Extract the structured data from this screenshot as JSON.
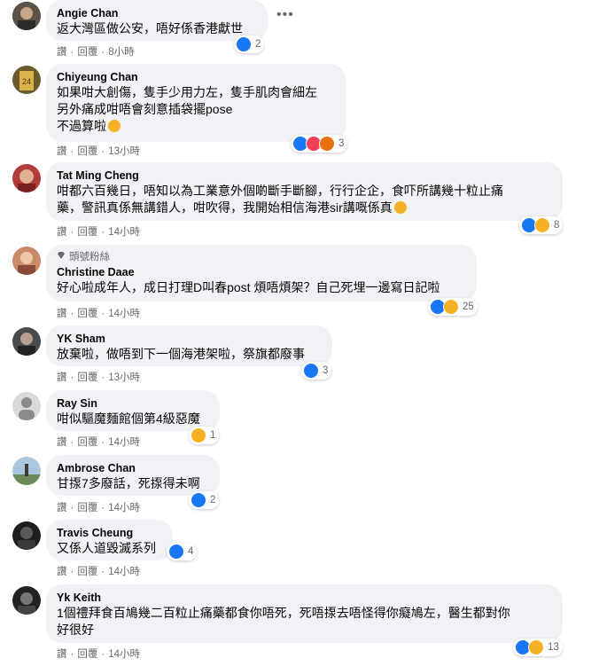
{
  "actions": {
    "like": "讚",
    "reply": "回覆"
  },
  "colors": {
    "bubble": "#f0f2f5",
    "like": "#1877f2",
    "love": "#f33e58",
    "haha": "#f7b125",
    "angry": "#e9710f",
    "meta": "#65676b"
  },
  "comments": [
    {
      "author": "Angie Chan",
      "lines": [
        "返大灣區做公安，唔好係香港獻世"
      ],
      "time": "8小時",
      "reactions": [
        "like"
      ],
      "count": "2"
    },
    {
      "author": "Chiyeung Chan",
      "lines": [
        "如果咁大創傷，隻手少用力左，隻手肌肉會細左",
        "另外痛成咁唔會刻意插袋擺pose",
        "不過算啦"
      ],
      "emoji": "slightly-smiling-face",
      "time": "13小時",
      "reactions": [
        "like",
        "love",
        "angry"
      ],
      "count": "3"
    },
    {
      "author": "Tat Ming Cheng",
      "lines": [
        "咁都六百幾日，唔知以為工業意外個啲斷手斷腳，行行企企，食吓所講幾十粒止痛",
        "藥，警訊真係無講錯人，咁吹得，我開始相信海港sir講嘅係真"
      ],
      "emoji": "rolling-laughing-face",
      "time": "14小時",
      "reactions": [
        "like",
        "haha"
      ],
      "count": "8"
    },
    {
      "author": "Christine Daae",
      "badge": "頭號粉絲",
      "badge_icon": "diamond-icon",
      "lines": [
        "好心啦成年人，成日打理D叫春post 煩唔煩架？自己死埋一邊寫日記啦"
      ],
      "time": "14小時",
      "reactions": [
        "like",
        "haha"
      ],
      "count": "25"
    },
    {
      "author": "YK Sham",
      "lines": [
        "放棄啦，做唔到下一個海港架啦，祭旗都廢事"
      ],
      "time": "13小時",
      "reactions": [
        "like"
      ],
      "count": "3"
    },
    {
      "author": "Ray Sin",
      "lines": [
        "咁似驅魔麵館個第4級惡魔"
      ],
      "time": "14小時",
      "reactions": [
        "haha"
      ],
      "count": "1"
    },
    {
      "author": "Ambrose Chan",
      "lines": [
        "甘揼7多廢話，死揼得未啊"
      ],
      "time": "14小時",
      "reactions": [
        "like"
      ],
      "count": "2"
    },
    {
      "author": "Travis Cheung",
      "lines": [
        "又係人道毀滅系列"
      ],
      "time": "14小時",
      "reactions": [
        "like"
      ],
      "count": "4"
    },
    {
      "author": "Yk Keith",
      "lines": [
        "1個禮拜食百鳩幾二百粒止痛藥都食你唔死，死唔揼去唔怪得你癡鳩左，醫生都對你",
        "好很好"
      ],
      "time": "14小時",
      "reactions": [
        "like",
        "haha"
      ],
      "count": "13"
    }
  ]
}
